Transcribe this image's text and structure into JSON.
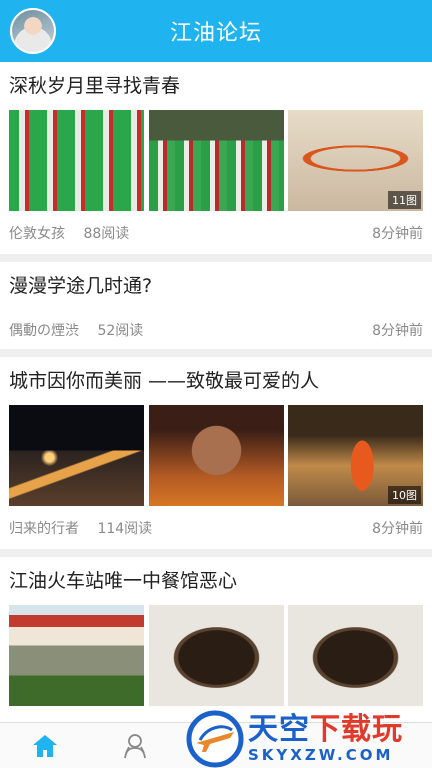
{
  "header": {
    "title": "江油论坛",
    "avatar_icon": "user-avatar"
  },
  "posts": [
    {
      "title": "深秋岁月里寻找青春",
      "author": "伦敦女孩",
      "reads": "88阅读",
      "time": "8分钟前",
      "image_count": "11图"
    },
    {
      "title": "漫漫学途几时通?",
      "author": "偶動の煙渋",
      "reads": "52阅读",
      "time": "8分钟前"
    },
    {
      "title": "城市因你而美丽 ——致敬最可爱的人",
      "author": "归来的行者",
      "reads": "114阅读",
      "time": "8分钟前",
      "image_count": "10图"
    },
    {
      "title": "江油火车站唯一中餐馆恶心"
    }
  ],
  "tabbar": {
    "tabs": [
      {
        "icon": "home-icon",
        "active": true,
        "color": "#1fb3f0"
      },
      {
        "icon": "community-icon",
        "active": false,
        "color": "#888888"
      }
    ]
  },
  "watermark": {
    "main_blue": "天空",
    "main_red": "下载玩",
    "sub": "SKYXZW.COM"
  },
  "colors": {
    "accent": "#1fb3f0"
  }
}
